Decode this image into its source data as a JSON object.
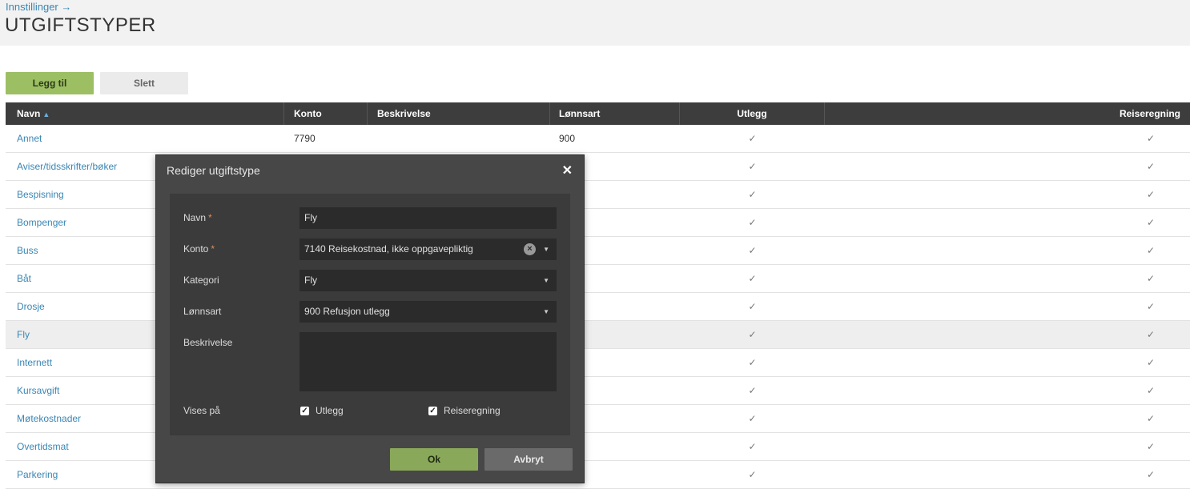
{
  "header": {
    "breadcrumb": "Innstillinger →",
    "title": "UTGIFTSTYPER"
  },
  "toolbar": {
    "add_label": "Legg til",
    "delete_label": "Slett"
  },
  "grid": {
    "columns": {
      "navn": "Navn",
      "konto": "Konto",
      "beskrivelse": "Beskrivelse",
      "lonnsart": "Lønnsart",
      "utlegg": "Utlegg",
      "reiseregning": "Reiseregning"
    },
    "sort_indicator": "▲",
    "rows": [
      {
        "navn": "Annet",
        "konto": "7790",
        "beskrivelse": "",
        "lonnsart": "900",
        "utlegg": "✓",
        "reiseregning": "✓"
      },
      {
        "navn": "Aviser/tidsskrifter/bøker",
        "konto": "",
        "beskrivelse": "",
        "lonnsart": "",
        "utlegg": "✓",
        "reiseregning": "✓"
      },
      {
        "navn": "Bespisning",
        "konto": "",
        "beskrivelse": "",
        "lonnsart": "",
        "utlegg": "✓",
        "reiseregning": "✓"
      },
      {
        "navn": "Bompenger",
        "konto": "",
        "beskrivelse": "",
        "lonnsart": "",
        "utlegg": "✓",
        "reiseregning": "✓"
      },
      {
        "navn": "Buss",
        "konto": "",
        "beskrivelse": "",
        "lonnsart": "",
        "utlegg": "✓",
        "reiseregning": "✓"
      },
      {
        "navn": "Båt",
        "konto": "",
        "beskrivelse": "",
        "lonnsart": "",
        "utlegg": "✓",
        "reiseregning": "✓"
      },
      {
        "navn": "Drosje",
        "konto": "",
        "beskrivelse": "",
        "lonnsart": "",
        "utlegg": "✓",
        "reiseregning": "✓"
      },
      {
        "navn": "Fly",
        "konto": "",
        "beskrivelse": "",
        "lonnsart": "",
        "utlegg": "✓",
        "reiseregning": "✓"
      },
      {
        "navn": "Internett",
        "konto": "",
        "beskrivelse": "",
        "lonnsart": "",
        "utlegg": "✓",
        "reiseregning": "✓"
      },
      {
        "navn": "Kursavgift",
        "konto": "",
        "beskrivelse": "",
        "lonnsart": "",
        "utlegg": "✓",
        "reiseregning": "✓"
      },
      {
        "navn": "Møtekostnader",
        "konto": "",
        "beskrivelse": "",
        "lonnsart": "",
        "utlegg": "✓",
        "reiseregning": "✓"
      },
      {
        "navn": "Overtidsmat",
        "konto": "",
        "beskrivelse": "",
        "lonnsart": "",
        "utlegg": "✓",
        "reiseregning": "✓"
      },
      {
        "navn": "Parkering",
        "konto": "",
        "beskrivelse": "",
        "lonnsart": "",
        "utlegg": "✓",
        "reiseregning": "✓"
      }
    ]
  },
  "dialog": {
    "title": "Rediger utgiftstype",
    "close_icon": "close-icon",
    "labels": {
      "navn": "Navn",
      "konto": "Konto",
      "kategori": "Kategori",
      "lonnsart": "Lønnsart",
      "beskrivelse": "Beskrivelse",
      "vises_pa": "Vises på"
    },
    "required_marker": "*",
    "values": {
      "navn": "Fly",
      "konto": "7140 Reisekostnad, ikke oppgavepliktig",
      "kategori": "Fly",
      "lonnsart": "900 Refusjon utlegg",
      "beskrivelse": ""
    },
    "checkboxes": {
      "utlegg_label": "Utlegg",
      "utlegg_checked": true,
      "reiseregning_label": "Reiseregning",
      "reiseregning_checked": true
    },
    "ok_label": "Ok",
    "cancel_label": "Avbryt"
  },
  "colors": {
    "primary_button": "#9dbf64",
    "link": "#3a86b4",
    "grid_header": "#3d3d3d",
    "dialog_bg": "#474747"
  }
}
